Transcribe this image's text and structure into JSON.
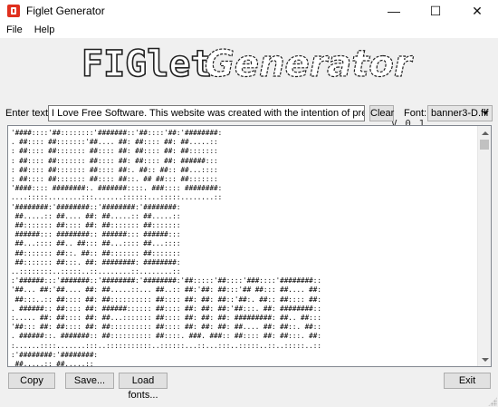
{
  "window": {
    "title": "Figlet Generator",
    "minimize_glyph": "—",
    "maximize_glyph": "☐",
    "close_glyph": "✕"
  },
  "menu": {
    "file": "File",
    "help": "Help"
  },
  "logo": {
    "text_figlet": "FIGlet",
    "text_generator": "Generator",
    "version": "V 0.1"
  },
  "controls": {
    "enter_text_label": "Enter text:",
    "input_value": "I Love Free Software. This website was created with the intention of presenting the best free software",
    "clear_label": "Clear",
    "font_label": "Font:",
    "font_value": "banner3-D.flf"
  },
  "output": {
    "text": "'####::::'##::::::::'#######::'##::::'##:'########:\n. ##:::: ##:::::::'##.... ##: ##:::: ##: ##.....::\n: ##:::: ##::::::: ##:::: ##: ##:::: ##: ##:::::::\n: ##:::: ##::::::: ##:::: ##: ##:::: ##: ######:::\n: ##:::: ##::::::: ##:::: ##:. ##:: ##:: ##...::::\n: ##:::: ##::::::: ##:::: ##::. ## ##::: ##:::::::\n'####:::: ########:. #######::::. ###:::: ########:\n....:::::........:::.......::::::...:::::........::\n'########:'########::'########:'########:\n ##.....:: ##.... ##: ##.....:: ##.....::\n ##::::::: ##:::: ##: ##::::::: ##:::::::\n ######::: ########:: ######::: ######:::\n ##...:::: ##.. ##::: ##...:::: ##...::::\n ##::::::: ##::. ##:: ##::::::: ##:::::::\n ##::::::: ##:::. ##: ########: ########:\n..::::::::..:::::..::........::........::\n:'######:::'#######::'########:'########:'##:::::'##::::'###::::'########::\n'##... ##:'##.... ##: ##.....::... ##..:: ##:'##: ##:::'## ##::: ##.... ##:\n ##:::..:: ##:::: ##: ##:::::::::: ##:::: ##: ##: ##::'##:. ##:: ##:::: ##:\n. ######:: ##:::: ##: ######:::::: ##:::: ##: ##: ##:'##:::. ##: ########::\n:..... ##: ##:::: ##: ##...::::::: ##:::: ##: ##: ##: #########: ##.. ##:::\n'##::: ##: ##:::: ##: ##:::::::::: ##:::: ##: ##: ##: ##.... ##: ##::. ##::\n. ######::. #######:: ##:::::::::: ##::::. ###. ###:: ##:::: ##: ##:::. ##:\n:......::::.......:::..:::::::::::..::::::...::...:::..:::::..::..:::::..::\n:'########:'########:\n ##.....:: ##.....::"
  },
  "buttons": {
    "copy": "Copy",
    "save": "Save...",
    "load_fonts": "Load fonts...",
    "exit": "Exit"
  },
  "colors": {
    "window_bg": "#f0f0f0",
    "app_icon": "#e0301e"
  }
}
